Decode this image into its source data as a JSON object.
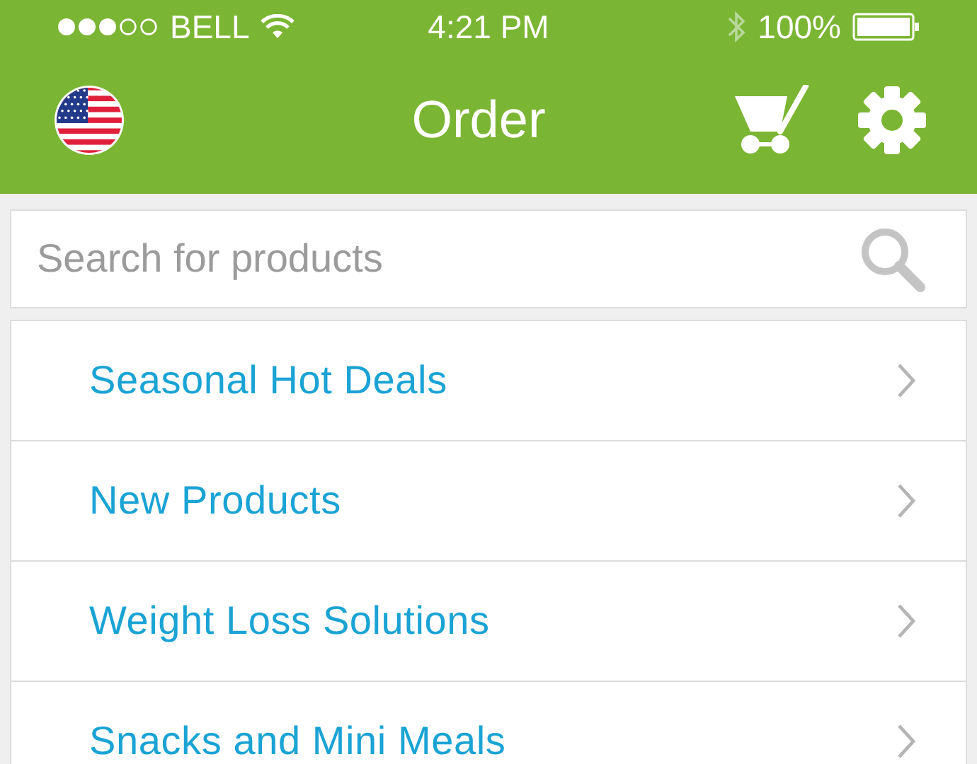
{
  "status_bar": {
    "carrier": "BELL",
    "time": "4:21 PM",
    "battery": "100%"
  },
  "nav_bar": {
    "title": "Order"
  },
  "search": {
    "placeholder": "Search for products"
  },
  "categories": [
    {
      "label": "Seasonal Hot Deals"
    },
    {
      "label": "New Products"
    },
    {
      "label": "Weight Loss Solutions"
    },
    {
      "label": "Snacks and Mini Meals"
    }
  ]
}
